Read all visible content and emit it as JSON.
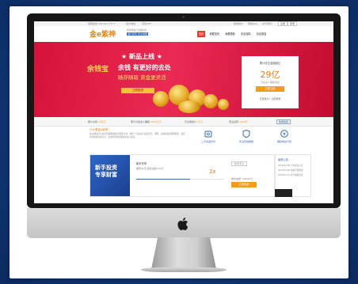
{
  "topbar": {
    "hotline": "客服热线 400-007-1577",
    "weixin": "官方微信",
    "app": "手机APP",
    "links": [
      "我的账户",
      "帮助中心",
      "关于我们"
    ],
    "register": "注册",
    "login": "登录"
  },
  "header": {
    "logo": "金e紫神",
    "slogan_top": "财富收益 稳健投资",
    "slogan_bottom": "银行存管 安全保障",
    "nav": [
      "首页",
      "我要投资",
      "我要借款",
      "安全保障",
      "信息披露"
    ],
    "nav_active_index": 0
  },
  "banner": {
    "headline": "新品上线",
    "product_logo": "余钱宝",
    "subhead": "余钱 有更好的去处",
    "tagline": "随存随取  资金更灵活",
    "cta": "立即投资",
    "invest_card": {
      "label": "累计成交金额超过",
      "amount": "29亿",
      "sub": "为投资人赚取收益",
      "button": "立即注册",
      "link": "已有账户？立即登录"
    }
  },
  "stats": {
    "items": [
      {
        "label": "累计交易",
        "value": "29亿元"
      },
      {
        "label": "累计为投资人赚取",
        "value": "9000万元"
      },
      {
        "label": "已注册用户",
        "value": "5万人"
      },
      {
        "label": "安全运营",
        "value": "1800天"
      }
    ],
    "pill": "数据披露"
  },
  "intro": {
    "title": "什么是金e紫神？",
    "text": "金e紫神是专业的互联网金融信息服务平台，致力于为投资人提供安全、透明、高效的投资理财服务，银行存管保障资金安全，多重风控体系保护投资人权益。"
  },
  "features": [
    {
      "label": "三方资金托管",
      "icon": "safe-icon"
    },
    {
      "label": "安全稳健保障",
      "icon": "shield-icon"
    },
    {
      "label": "理财收益可观",
      "icon": "coin-icon"
    }
  ],
  "newbie": {
    "title_1": "新手投资",
    "title_2": "专享财富",
    "product_name": "新手专享",
    "desc": "期限30天  起投金额100元",
    "rate": "2x",
    "progress": 0.62,
    "tag": "新手专享",
    "amount": "剩余金额 100000元",
    "button": "立即投资"
  },
  "notice": {
    "title": "最新公告",
    "items": [
      "2018-03-08 平台运营公告",
      "2018-03-06 系统升级通知",
      "2018-03-01 春节放假安排"
    ]
  },
  "colors": {
    "brand": "#ef7b1a",
    "banner": "#e0183f",
    "link": "#3a6ab0",
    "background": "#123a7c"
  }
}
